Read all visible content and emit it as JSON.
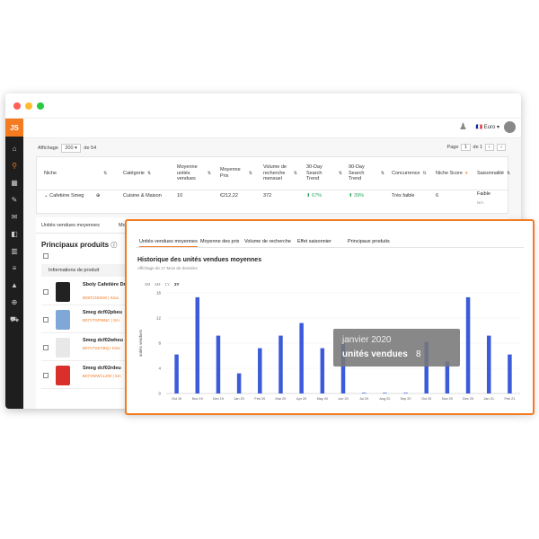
{
  "sidebar": {
    "logo": "JS",
    "icons": [
      "home-icon",
      "search-icon",
      "map-icon",
      "tools-icon",
      "megaphone-icon",
      "trend-icon",
      "chart-icon",
      "stack-icon",
      "school-icon",
      "help-icon",
      "cart-icon"
    ],
    "icon_glyphs": [
      "⌂",
      "⚲",
      "▦",
      "✎",
      "✉",
      "◧",
      "▥",
      "≡",
      "▲",
      "⊕",
      "⛟"
    ]
  },
  "topbar": {
    "bell": "♟",
    "currency": "Euro"
  },
  "filters": {
    "label": "Affichage",
    "count": "200",
    "of": "de 54"
  },
  "pager": {
    "label": "Page",
    "current": "1",
    "total": "de 1",
    "prev": "‹",
    "next": "›"
  },
  "table": {
    "headers": [
      "Niche",
      "Catégorie",
      "Moyenne unités vendues",
      "Moyenne Prix",
      "Volume de recherche mensuel",
      "30-Day Search Trend",
      "90-Day Search Trend",
      "Concurrence",
      "Niche Score",
      "Saisonnalité"
    ],
    "row": {
      "niche": "Cafetière Smeg",
      "category": "Cuisine & Maison",
      "units": "10",
      "price": "€212,22",
      "volume": "372",
      "trend30": "⬆ 67%",
      "trend90": "⬆ 39%",
      "competition": "Très faible",
      "score": "6",
      "seasonality": "Faible",
      "seasonality_sub": "N/A"
    }
  },
  "tabs": [
    "Unités vendues moyennes",
    "Moye"
  ],
  "products": {
    "title": "Principaux produits",
    "header": "Informations de produit",
    "items": [
      {
        "name": "Sboly Cafetière Dr Acier inoxydable,",
        "asin": "B08TCN8SW | Sma"
      },
      {
        "name": "Smeg dcf02pbeu",
        "asin": "B07VTSPWNC | Sm"
      },
      {
        "name": "Smeg dcf02wheu",
        "asin": "B07VTSZYBQ | Sme"
      },
      {
        "name": "Smeg dcf02rdeu",
        "asin": "B07VWWCLZW | Sm"
      }
    ]
  },
  "popup": {
    "tabs": [
      "Unités vendues moyennes",
      "Moyenne des prix",
      "Volume de recherche",
      "Effet saisonnier",
      "Principaux produits"
    ],
    "title": "Historique des unités vendues moyennes",
    "subtitle": "Affichage de 17 Mois de données",
    "ranges": [
      "3M",
      "6M",
      "1Y",
      "2Y"
    ],
    "active_range": "2Y",
    "tooltip": {
      "month": "janvier 2020",
      "label": "unités vendues",
      "value": "8"
    }
  },
  "chart_data": {
    "type": "bar",
    "title": "Historique des unités vendues moyennes",
    "ylabel": "unités vendues",
    "ylim": [
      0,
      16
    ],
    "yticks": [
      0,
      4,
      8,
      12,
      16
    ],
    "categories": [
      "Oct 19",
      "Nov 19",
      "Dec 19",
      "Jan 20",
      "Feb 20",
      "Mar 20",
      "Apr 20",
      "May 20",
      "Jun 20",
      "Jul 20",
      "Aug 20",
      "Sep 20",
      "Oct 20",
      "Nov 20",
      "Dec 20",
      "Jan 21",
      "Feb 21"
    ],
    "values": [
      6.2,
      15.3,
      9.2,
      3.2,
      7.2,
      9.2,
      11.2,
      7.2,
      8.0,
      0.1,
      0.1,
      0.1,
      8.2,
      5.1,
      15.3,
      9.2,
      6.2
    ],
    "color": "#3b5bdb"
  }
}
